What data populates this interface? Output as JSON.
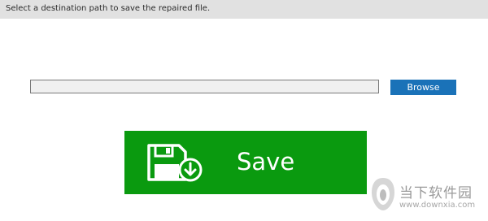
{
  "header": {
    "instruction": "Select a destination path to save the repaired file."
  },
  "path_field": {
    "value": ""
  },
  "browse": {
    "label": "Browse"
  },
  "save": {
    "label": "Save",
    "icon": "floppy-disk-download-icon"
  },
  "watermark": {
    "title": "当下软件园",
    "url": "www.downxia.com"
  },
  "colors": {
    "header_bg": "#e1e1e1",
    "browse_bg": "#1a72b8",
    "save_bg": "#0a9a0f"
  }
}
